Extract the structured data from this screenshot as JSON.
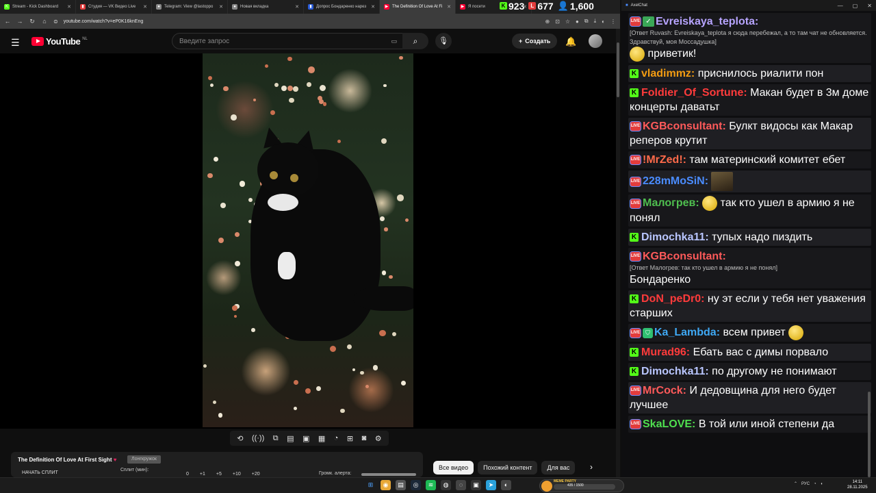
{
  "browser": {
    "tabs": [
      {
        "label": "Stream - Kick Dashboard",
        "color": "#53fc18",
        "glyph": "K"
      },
      {
        "label": "Студия — VK Видео Live",
        "color": "#e23c3c",
        "glyph": "▮"
      },
      {
        "label": "Telegram: View @lastoppo",
        "color": "#888888",
        "glyph": "●"
      },
      {
        "label": "Новая вкладка",
        "color": "#888888",
        "glyph": "●"
      },
      {
        "label": "Допрос Бондаренко нарез",
        "color": "#2a5bd7",
        "glyph": "▮"
      },
      {
        "label": "The Definition Of Love At Fi",
        "color": "#ff0033",
        "glyph": "▶",
        "active": true
      },
      {
        "label": "Я посети",
        "color": "#ff0033",
        "glyph": "▶"
      }
    ],
    "url": "youtube.com/watch?v=eP0K16knEng"
  },
  "stats": {
    "kick": "923",
    "vk": "677",
    "viewers": "1,600"
  },
  "youtube": {
    "logo": "YouTube",
    "region": "NL",
    "search_placeholder": "Введите запрос",
    "create_label": "Создать",
    "video_title": "The Definition Of Love At First Sight",
    "badge": "Лонгкружок",
    "split_start": "НАЧАТЬ СПЛИТ",
    "split_label": "Сплит (мин):",
    "split_nums": [
      "0",
      "+1",
      "+5",
      "+10",
      "+20"
    ],
    "alert_label": "Громк. алерта:",
    "chips": [
      "Все видео",
      "Похожий контент",
      "Для вас"
    ]
  },
  "chat": {
    "window_title": "AxelChat",
    "messages": [
      {
        "badges": [
          "live",
          "check"
        ],
        "user": "Evreiskaya_teplota:",
        "color": "#b7a4ff",
        "reply": "[Ответ Ruvash: Evreiskaya_teplota я сюда перебежал, а то там чат не обновляется. Здравствуй, моя Моссадушка]",
        "text": "приветик!",
        "emote": "smile"
      },
      {
        "badges": [
          "k"
        ],
        "user": "vladimmz:",
        "color": "#f39c12",
        "text": "приснилось риалити пон"
      },
      {
        "badges": [
          "k"
        ],
        "user": "Foldier_Of_Sortune:",
        "color": "#ff3b3b",
        "text": "Макан будет в 3м доме концерты даватьт"
      },
      {
        "badges": [
          "live"
        ],
        "user": "KGBconsultant:",
        "color": "#ff5a5a",
        "text": "Булкт видосы как Макар реперов крутит"
      },
      {
        "badges": [
          "live"
        ],
        "user": "!MrZed!:",
        "color": "#ff6a4a",
        "text": "там материнский комитет ебет"
      },
      {
        "badges": [
          "live"
        ],
        "user": "228mMoSiN:",
        "color": "#4a8cff",
        "text": "",
        "emote": "image"
      },
      {
        "badges": [
          "live"
        ],
        "user": "Малогрев:",
        "color": "#4fbf4f",
        "text": "так кто ушел в армию я не понял",
        "emote_before": "smile"
      },
      {
        "badges": [
          "k"
        ],
        "user": "Dimochka11:",
        "color": "#b9c6ff",
        "text": "тупых надо пиздить"
      },
      {
        "badges": [
          "live"
        ],
        "user": "KGBconsultant:",
        "color": "#ff5a5a",
        "reply": "[Ответ Малогрев: так кто ушел в армию я не понял]",
        "text": "Бондаренко"
      },
      {
        "badges": [
          "k"
        ],
        "user": "DoN_peDr0:",
        "color": "#ff3b3b",
        "text": "ну эт если у тебя нет уважения старших"
      },
      {
        "badges": [
          "live",
          "shield"
        ],
        "user": "Ka_Lambda:",
        "color": "#3fa9f5",
        "text": "всем привет",
        "emote": "smile"
      },
      {
        "badges": [
          "k"
        ],
        "user": "Murad96:",
        "color": "#ff3b3b",
        "text": "Ебать вас с димы порвало"
      },
      {
        "badges": [
          "k"
        ],
        "user": "Dimochka11:",
        "color": "#b9c6ff",
        "text": "по другому не понимают"
      },
      {
        "badges": [
          "live"
        ],
        "user": "MrCock:",
        "color": "#ff5a5a",
        "text": "И дедовщина для него будет лучшее"
      },
      {
        "badges": [
          "live"
        ],
        "user": "SkaLOVE:",
        "color": "#4fdf4f",
        "text": "В той или иной степени да"
      }
    ]
  },
  "taskbar": {
    "meme_title": "MEME PARTY",
    "meme_progress": "435 / 1500",
    "language": "РУС",
    "time": "14:11",
    "date": "28.11.2025"
  }
}
